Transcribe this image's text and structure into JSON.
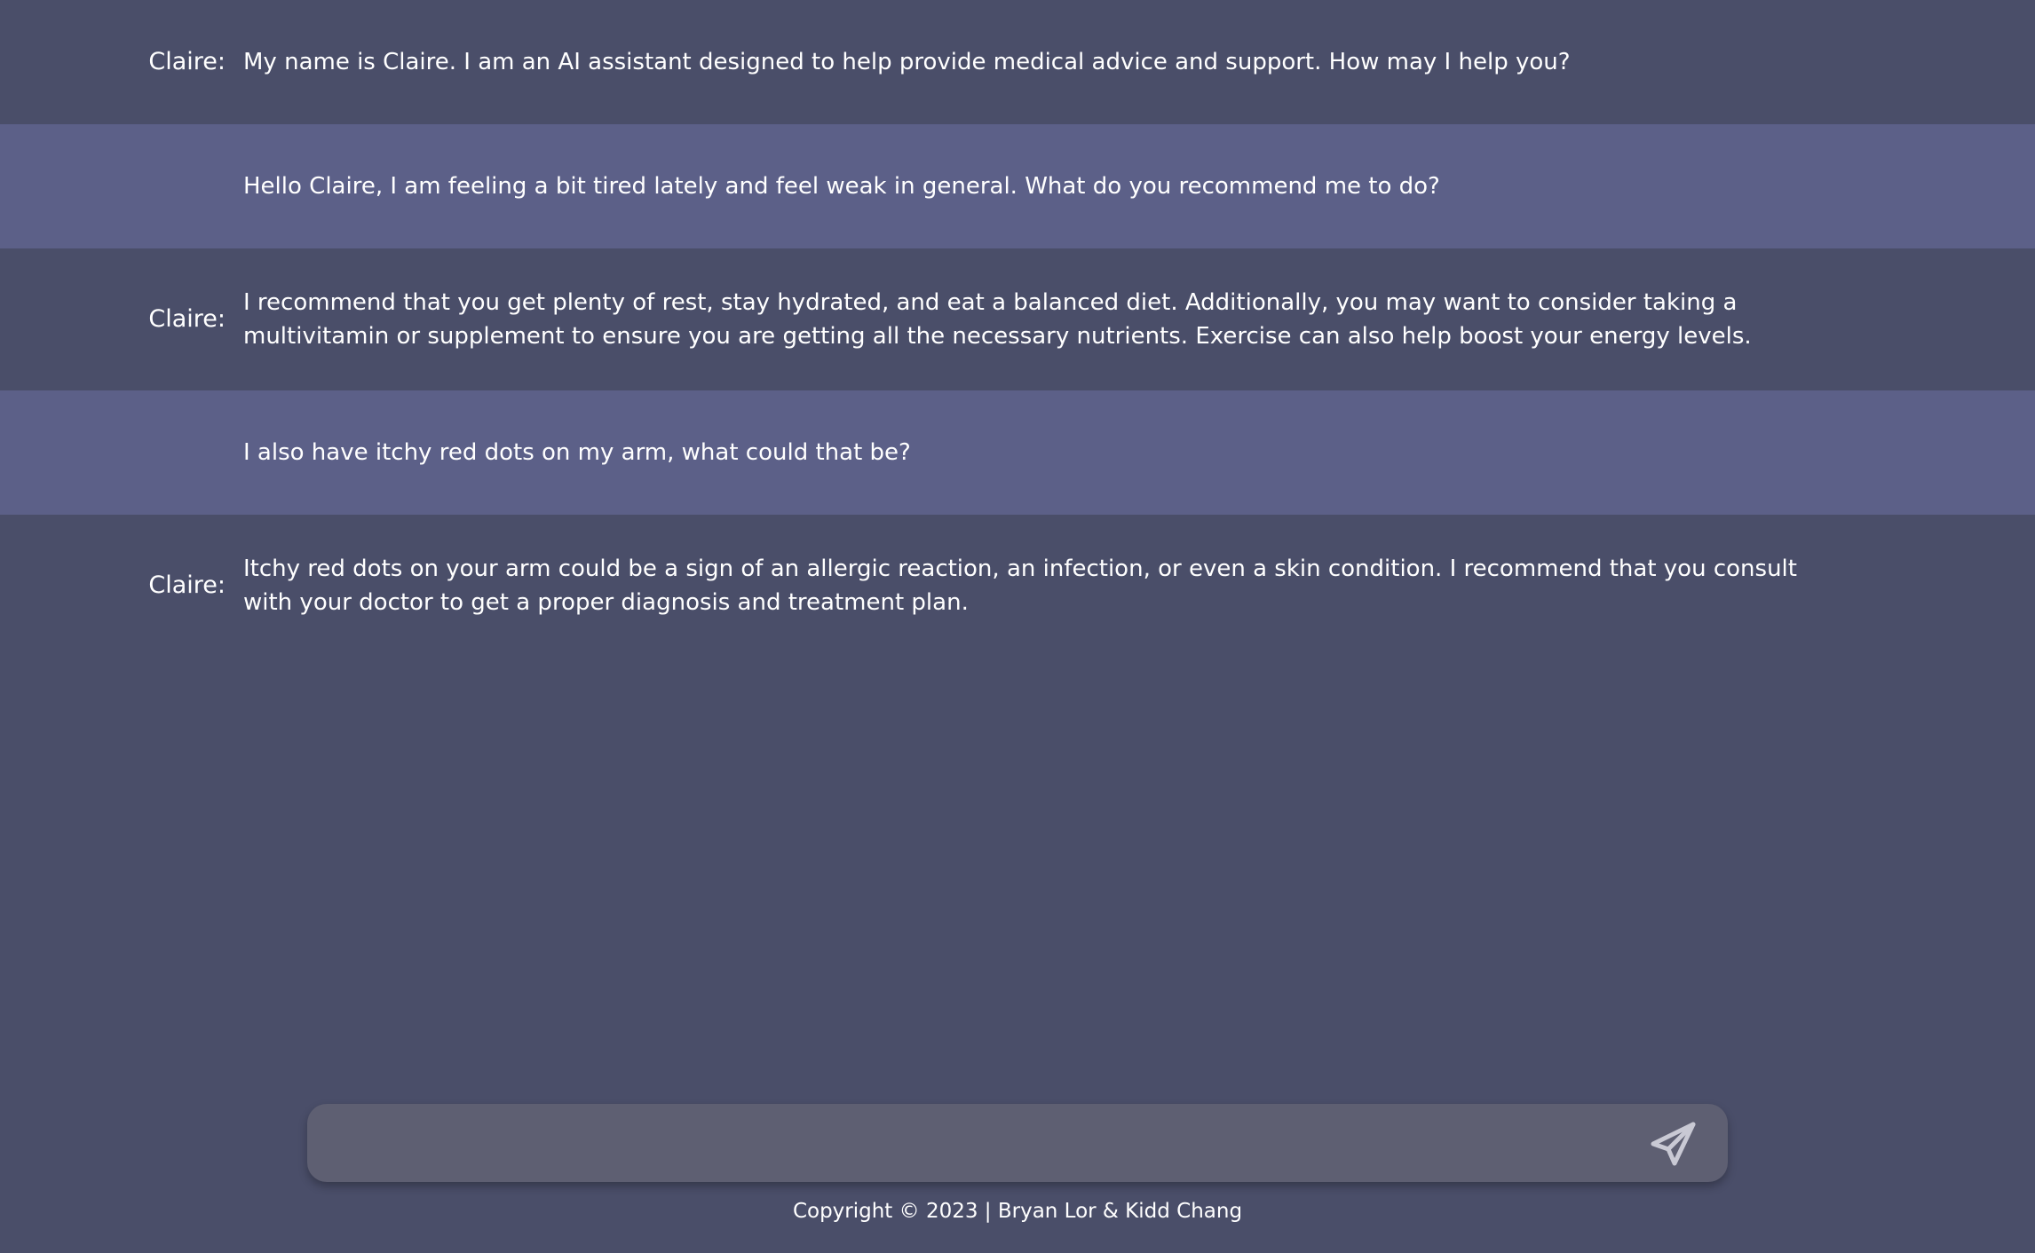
{
  "messages": [
    {
      "role": "assistant",
      "speaker": "Claire:",
      "text": "My name is Claire. I am an AI assistant designed to help provide medical advice and support. How may I help you?"
    },
    {
      "role": "user",
      "speaker": "",
      "text": "Hello Claire, I am feeling a bit tired lately and feel weak in general. What do you recommend me to do?"
    },
    {
      "role": "assistant",
      "speaker": "Claire:",
      "text": "I recommend that you get plenty of rest, stay hydrated, and eat a balanced diet. Additionally, you may want to consider taking a multivitamin or supplement to ensure you are getting all the necessary nutrients. Exercise can also help boost your energy levels."
    },
    {
      "role": "user",
      "speaker": "",
      "text": "I also have itchy red dots on my arm, what could that be?"
    },
    {
      "role": "assistant",
      "speaker": "Claire:",
      "text": "Itchy red dots on your arm could be a sign of an allergic reaction, an infection, or even a skin condition. I recommend that you consult with your doctor to get a proper diagnosis and treatment plan."
    }
  ],
  "composer": {
    "value": "",
    "placeholder": "",
    "send_icon": "send-icon"
  },
  "footer": {
    "copyright": "Copyright © 2023 | Bryan Lor & Kidd Chang"
  },
  "colors": {
    "background": "#4a4e69",
    "user_row": "#5c6088",
    "input": "#5e5f72",
    "text": "#ffffff"
  }
}
